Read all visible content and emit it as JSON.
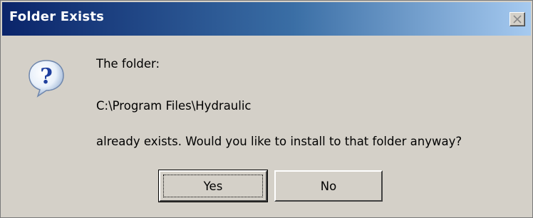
{
  "dialog": {
    "title": "Folder Exists",
    "close_icon": "close-icon",
    "icon": "question-icon",
    "message_line1": "The folder:",
    "folder_path": "C:\\Program Files\\Hydraulic",
    "message_line3": "already exists. Would you like to install to that folder anyway?",
    "yes_label": "Yes",
    "no_label": "No"
  },
  "colors": {
    "title_gradient_start": "#0a246a",
    "title_gradient_end": "#a6caf0",
    "face": "#d4d0c8"
  }
}
